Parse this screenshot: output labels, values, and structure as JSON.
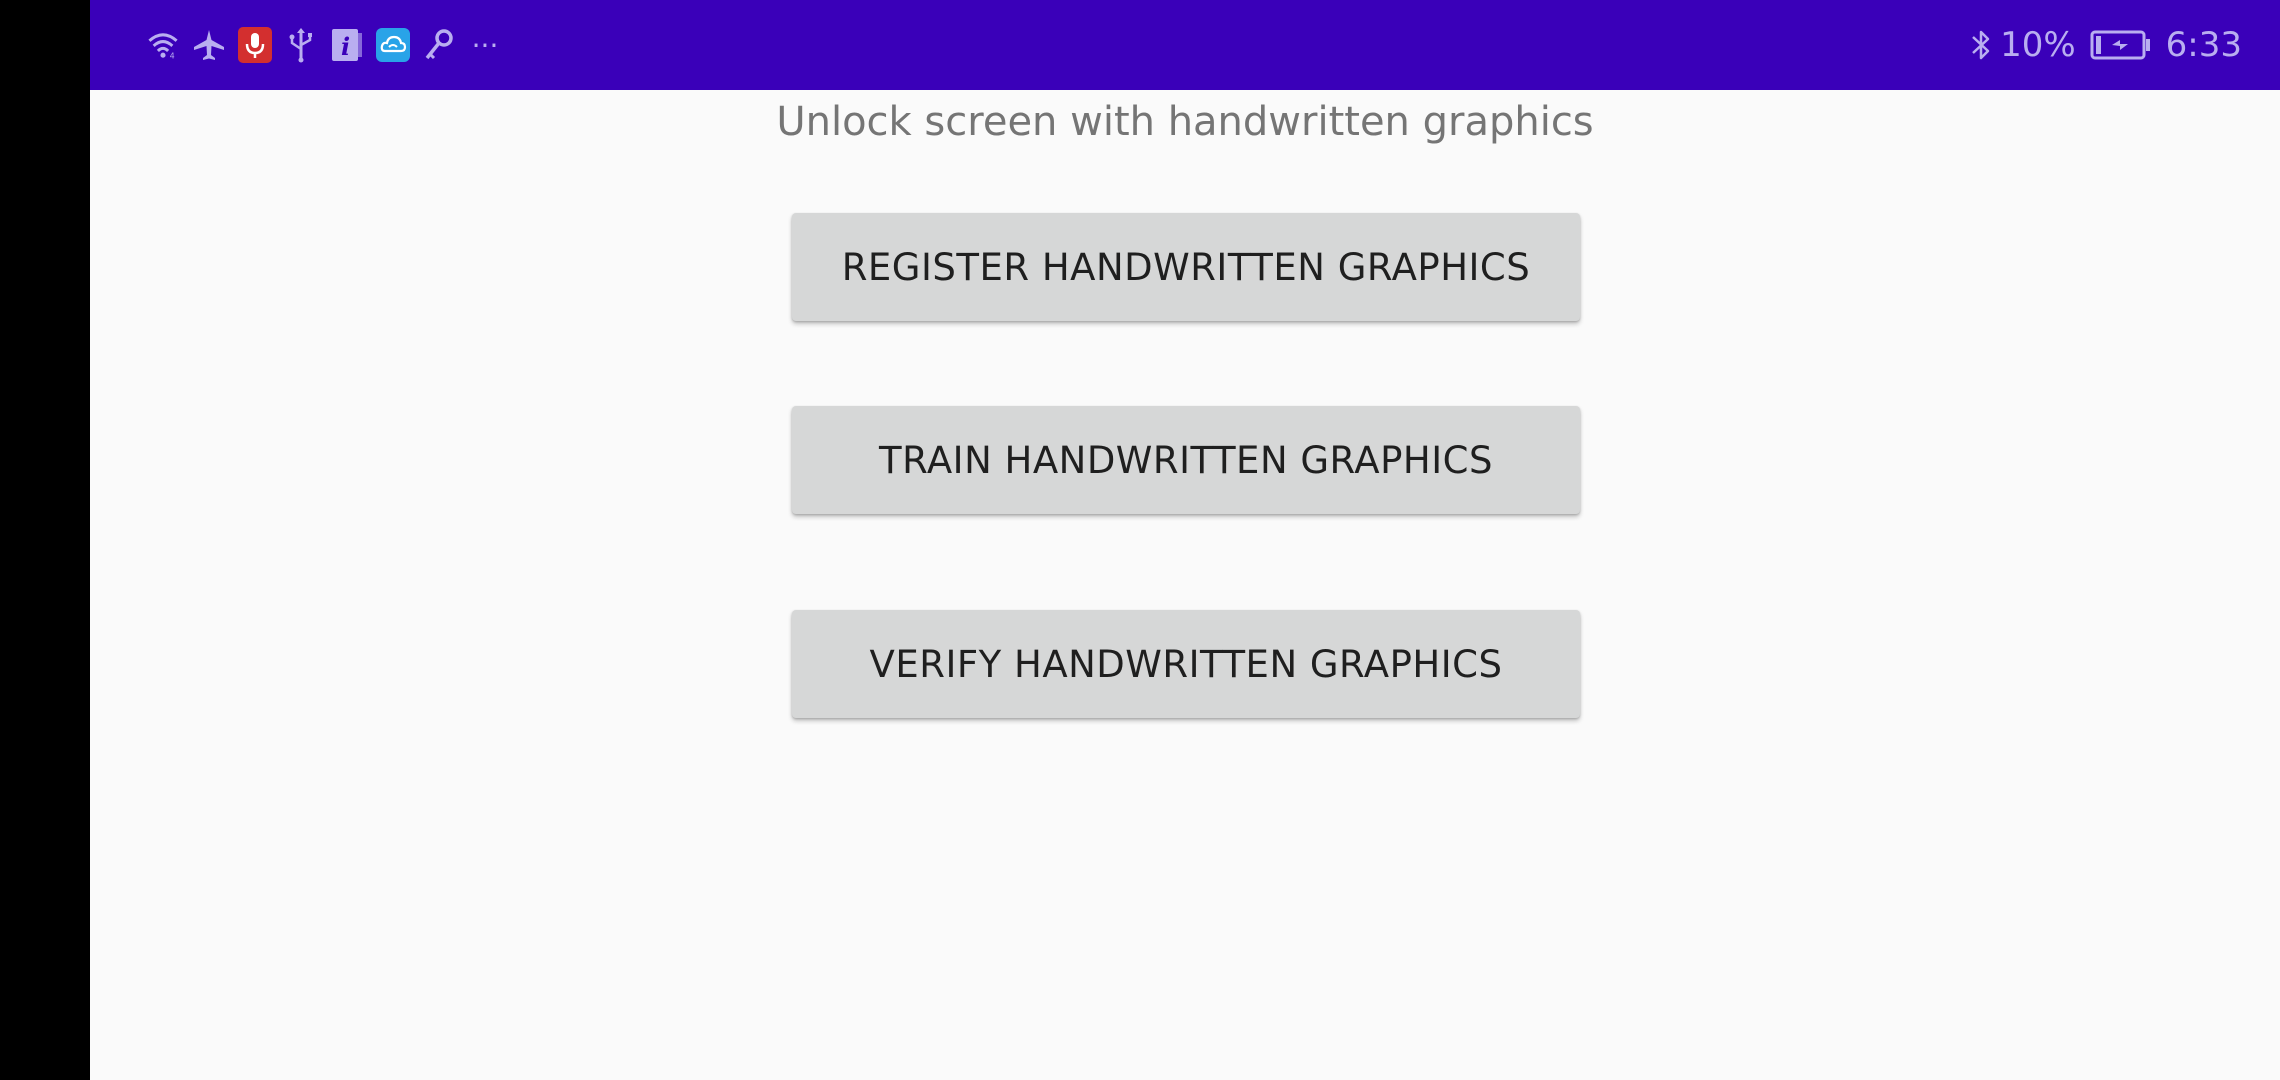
{
  "status_bar": {
    "icons": [
      "wifi-icon",
      "airplane-icon",
      "microphone-icon",
      "usb-icon",
      "info-icon",
      "cloud-icon",
      "key-icon",
      "more-icon"
    ],
    "more_glyph": "···",
    "battery_percent": "10%",
    "time": "6:33",
    "colors": {
      "background": "#3a00b9",
      "foreground": "#b9aef0",
      "mic_badge": "#d32f2f",
      "cloud_badge": "#29a3e8"
    }
  },
  "main": {
    "subtitle": "Unlock screen with handwritten graphics",
    "buttons": [
      {
        "label": "REGISTER HANDWRITTEN GRAPHICS"
      },
      {
        "label": "TRAIN HANDWRITTEN GRAPHICS"
      },
      {
        "label": "VERIFY HANDWRITTEN GRAPHICS"
      }
    ]
  }
}
